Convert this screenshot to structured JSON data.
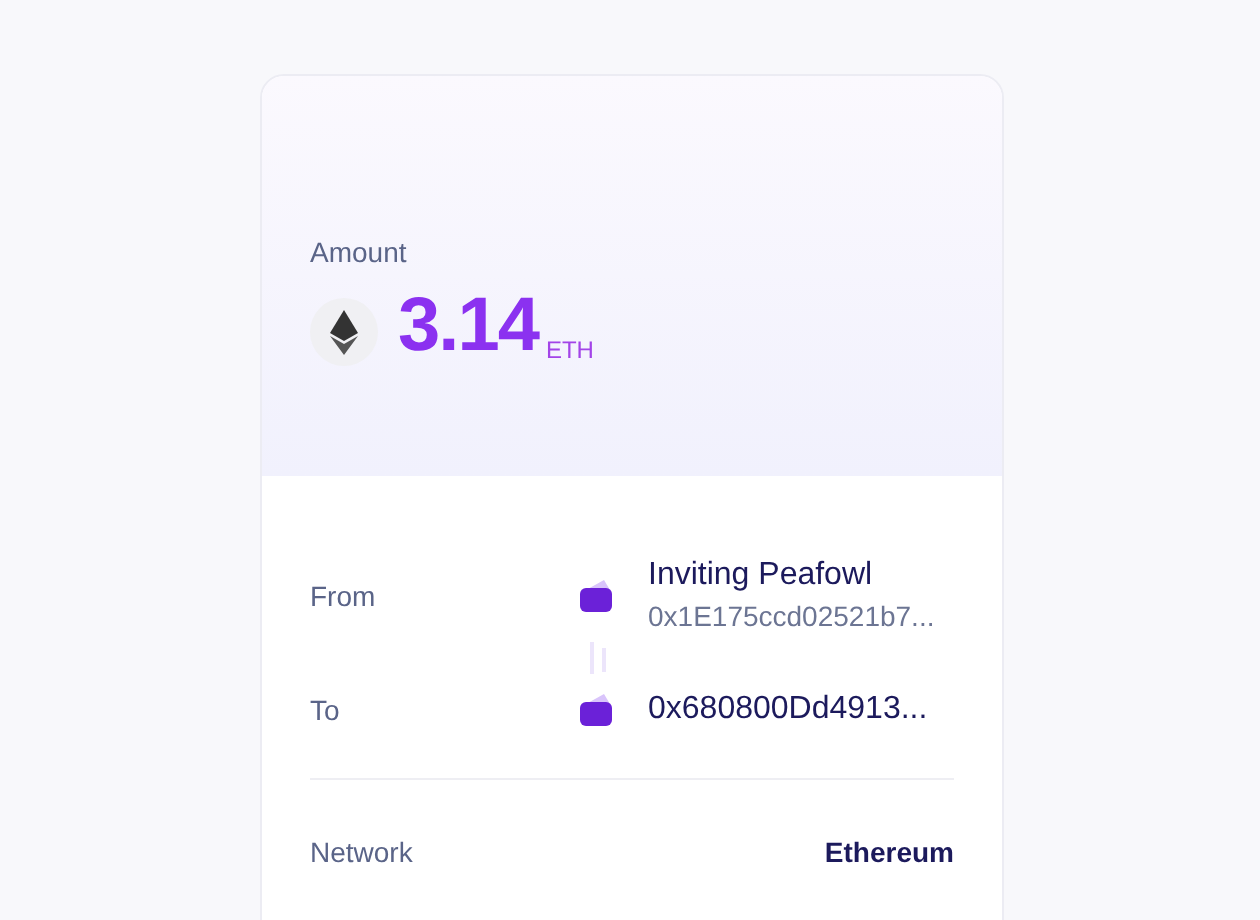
{
  "amount": {
    "label": "Amount",
    "value": "3.14",
    "unit": "ETH"
  },
  "from": {
    "label": "From",
    "name": "Inviting Peafowl",
    "address": "0x1E175ccd02521b7..."
  },
  "to": {
    "label": "To",
    "address": "0x680800Dd4913..."
  },
  "network": {
    "label": "Network",
    "value": "Ethereum"
  }
}
